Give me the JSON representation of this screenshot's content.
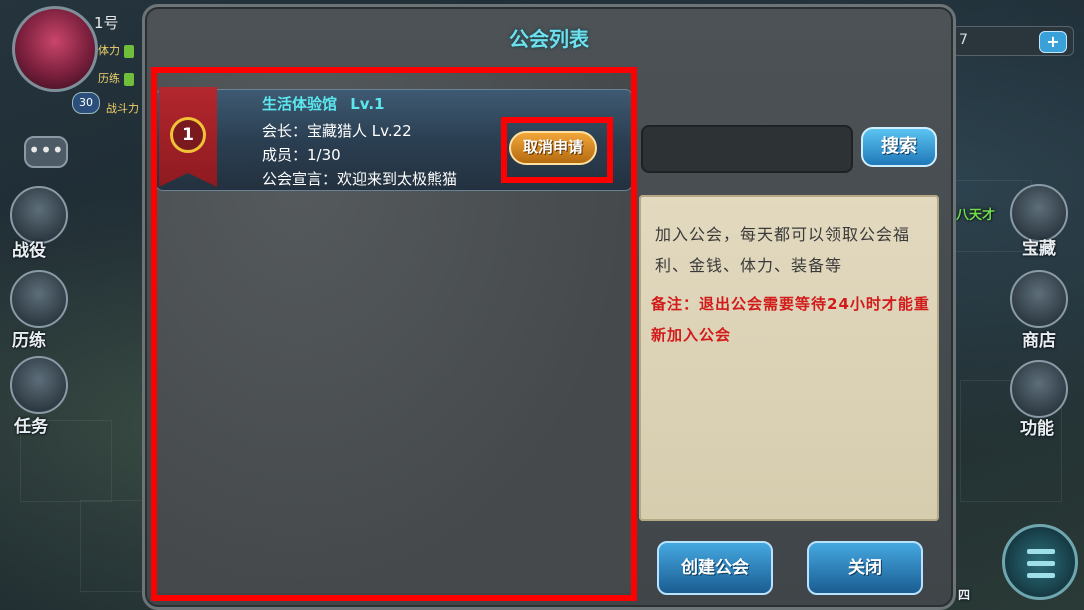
{
  "hud": {
    "player_name": "1号",
    "stamina_label": "体力",
    "training_label": "历练",
    "level": "30",
    "power_label": "战斗力",
    "chat_icon": "•••",
    "left_buttons": [
      "战役",
      "历练",
      "任务"
    ],
    "right_counter": "7",
    "right_plus": "+",
    "right_buttons": [
      "宝藏",
      "商店",
      "功能"
    ],
    "right_fragment": "八天才",
    "bottom_fragment": "四"
  },
  "dialog": {
    "title": "公会列表",
    "guild": {
      "rank": "1",
      "name": "生活体验馆",
      "level": "Lv.1",
      "leader": "会长：宝藏猎人  Lv.22",
      "members": "成员：1/30",
      "declaration": "公会宣言：欢迎来到太极熊猫"
    },
    "cancel_button": "取消申请",
    "search_button": "搜索",
    "search_placeholder": "",
    "info_text": "加入公会，每天都可以领取公会福利、金钱、体力、装备等",
    "info_note": "备注：退出公会需要等待24小时才能重新加入公会",
    "create_button": "创建公会",
    "close_button": "关闭"
  },
  "colors": {
    "title": "#6fe0ee",
    "guild_name": "#5ce7ef",
    "note": "#d21b1b",
    "highlight": "#ff0000"
  }
}
